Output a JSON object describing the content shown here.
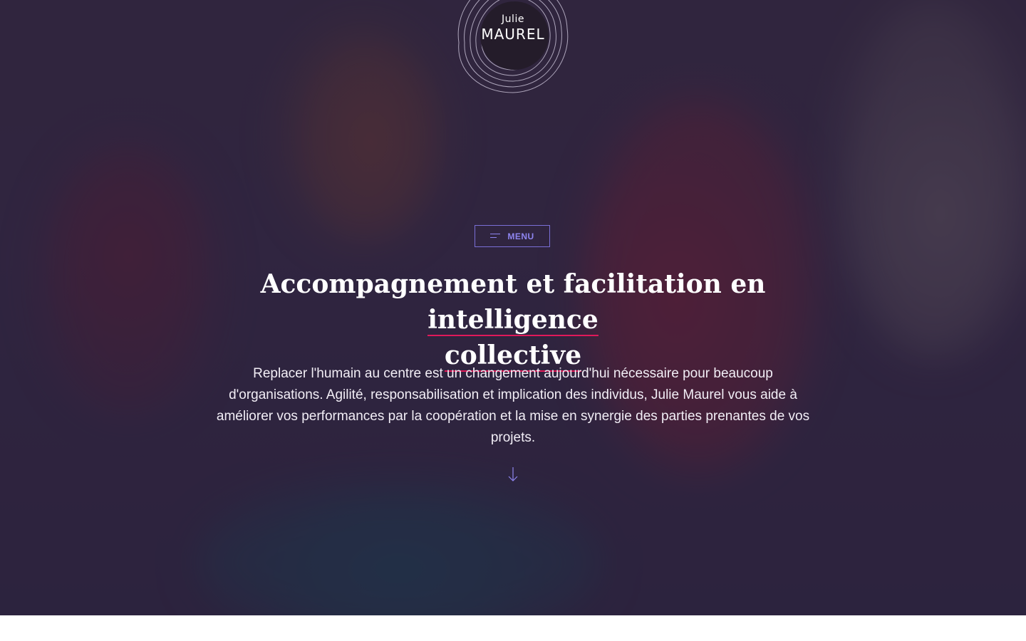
{
  "logo": {
    "first_name": "Julie",
    "last_name": "MAUREL"
  },
  "menu": {
    "label": "MENU",
    "icon": "menu-lines-icon"
  },
  "hero": {
    "title_part1": "Accompagnement et facilitation en ",
    "title_highlight1": "intelligence",
    "title_highlight2": "collective",
    "description": "Replacer l'humain au centre est un changement aujourd'hui nécessaire pour beaucoup d'organisations. Agilité, responsabilisation et implication des individus, Julie Maurel vous aide à améliorer vos performances par la coopération et la mise en synergie des parties prenantes de vos projets.",
    "scroll_icon": "arrow-down-icon"
  },
  "colors": {
    "accent": "#8e85f0",
    "underline": "#e0195a",
    "overlay": "#281e3c"
  }
}
